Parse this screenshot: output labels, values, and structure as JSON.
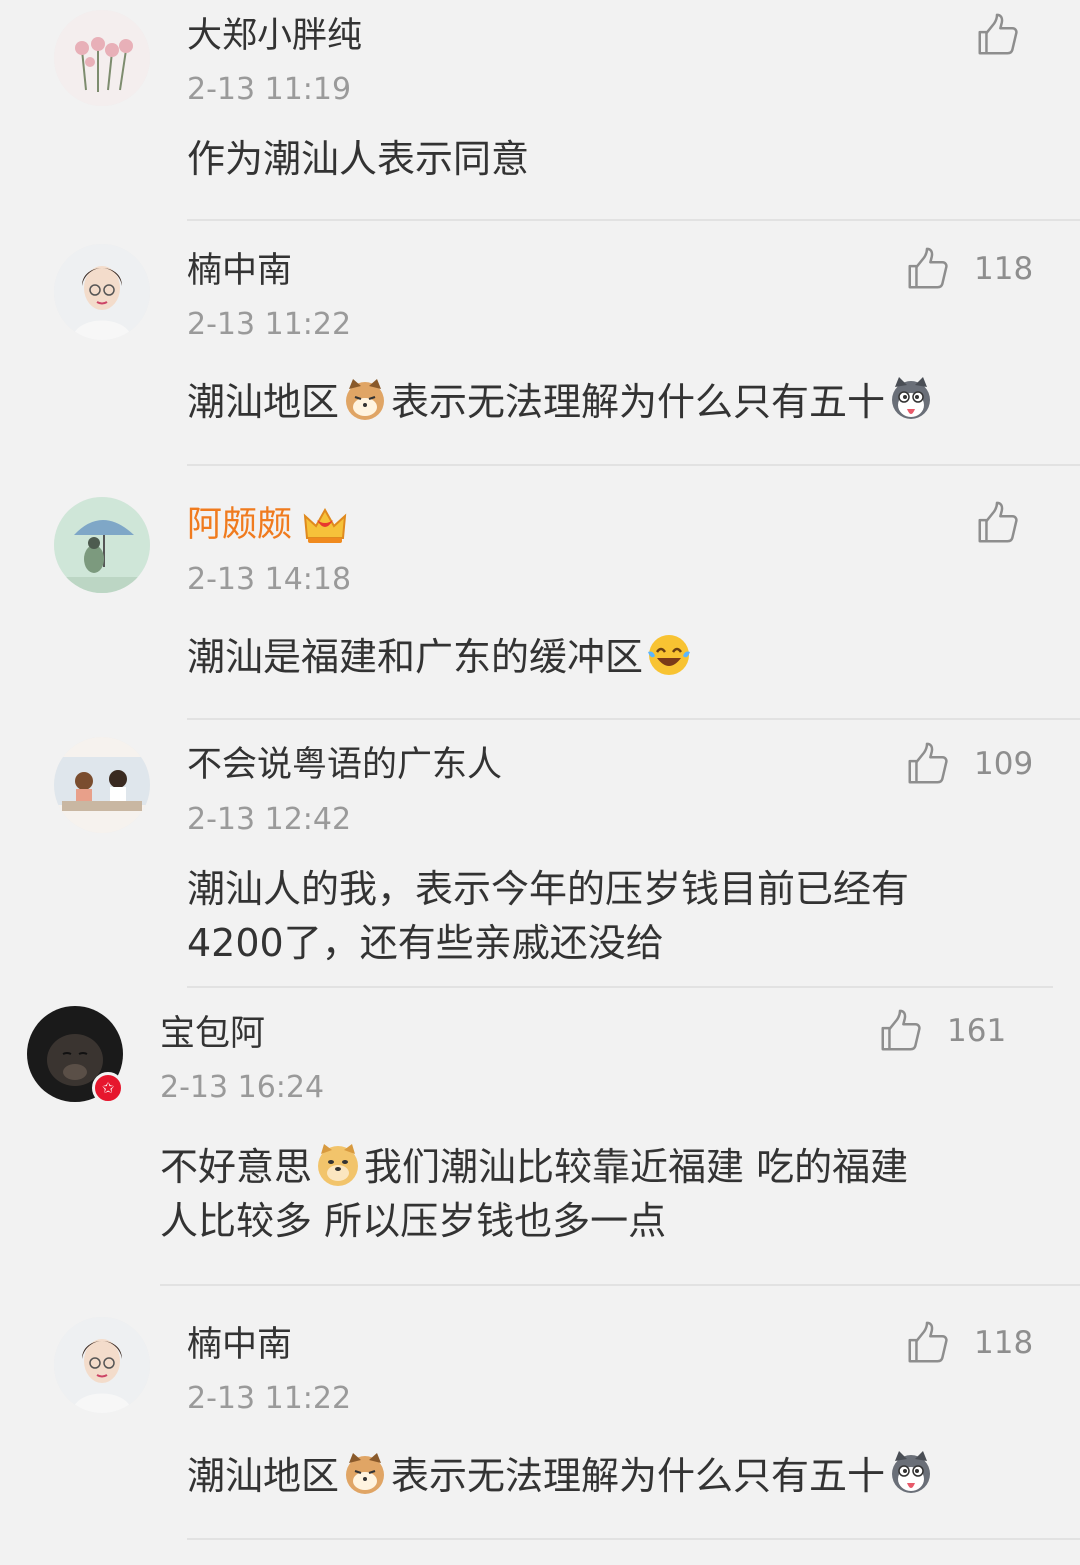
{
  "comments": [
    {
      "username": "大郑小胖纯",
      "time": "2-13 11:19",
      "likes": "",
      "text": [
        "作为潮汕人表示同意"
      ]
    },
    {
      "username": "楠中南",
      "time": "2-13 11:22",
      "likes": "118",
      "text_parts": [
        "潮汕地区",
        "表示无法理解为什么只有五十"
      ]
    },
    {
      "username": "阿颇颇",
      "time": "2-13 14:18",
      "likes": "",
      "text_parts": [
        "潮汕是福建和广东的缓冲区"
      ]
    },
    {
      "username": "不会说粤语的广东人",
      "time": "2-13 12:42",
      "likes": "109",
      "text": [
        "潮汕人的我，表示今年的压岁钱目前已经有",
        "4200了，还有些亲戚还没给"
      ]
    },
    {
      "username": "宝包阿",
      "time": "2-13 16:24",
      "likes": "161",
      "text_parts": [
        "不好意思",
        "我们潮汕比较靠近福建 吃的福建",
        "人比较多 所以压岁钱也多一点"
      ]
    },
    {
      "username": "楠中南",
      "time": "2-13 11:22",
      "likes": "118",
      "text_parts": [
        "潮汕地区",
        "表示无法理解为什么只有五十"
      ]
    }
  ],
  "colors": {
    "background": "#f2f2f2",
    "vip_name": "#f07b1e",
    "timestamp": "#9a9a9a",
    "badge": "#e6162d"
  }
}
